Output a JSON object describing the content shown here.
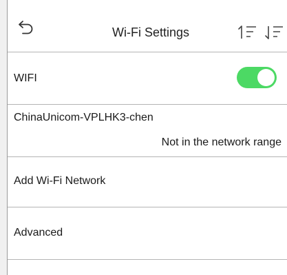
{
  "header": {
    "title": "Wi-Fi Settings",
    "back_icon": "back-arrow-icon",
    "sort_asc_icon": "sort-ascending-icon",
    "sort_desc_icon": "sort-descending-icon"
  },
  "wifi_toggle": {
    "label": "WIFI",
    "state": "on",
    "on_color": "#4cd964"
  },
  "networks": [
    {
      "ssid": "ChinaUnicom-VPLHK3-chen",
      "status": "Not in the network range"
    }
  ],
  "menu": {
    "add_network_label": "Add Wi-Fi Network",
    "advanced_label": "Advanced"
  }
}
